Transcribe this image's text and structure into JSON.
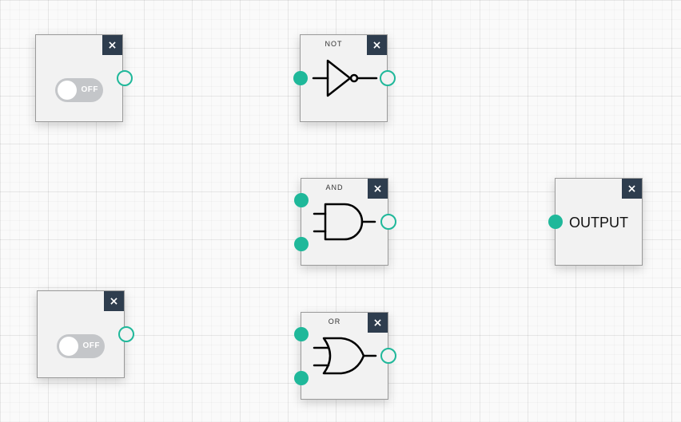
{
  "close_glyph": "×",
  "colors": {
    "port": "#1fb89a",
    "close_bg": "#2e3d4e",
    "node_bg": "#f2f2f2",
    "toggle_off": "#c4c6c9"
  },
  "inputs": [
    {
      "state_label": "OFF"
    },
    {
      "state_label": "OFF"
    }
  ],
  "gates": {
    "not": {
      "title": "NOT",
      "icon": "not-gate-icon"
    },
    "and": {
      "title": "AND",
      "icon": "and-gate-icon"
    },
    "or": {
      "title": "OR",
      "icon": "or-gate-icon"
    }
  },
  "output": {
    "label": "OUTPUT"
  }
}
